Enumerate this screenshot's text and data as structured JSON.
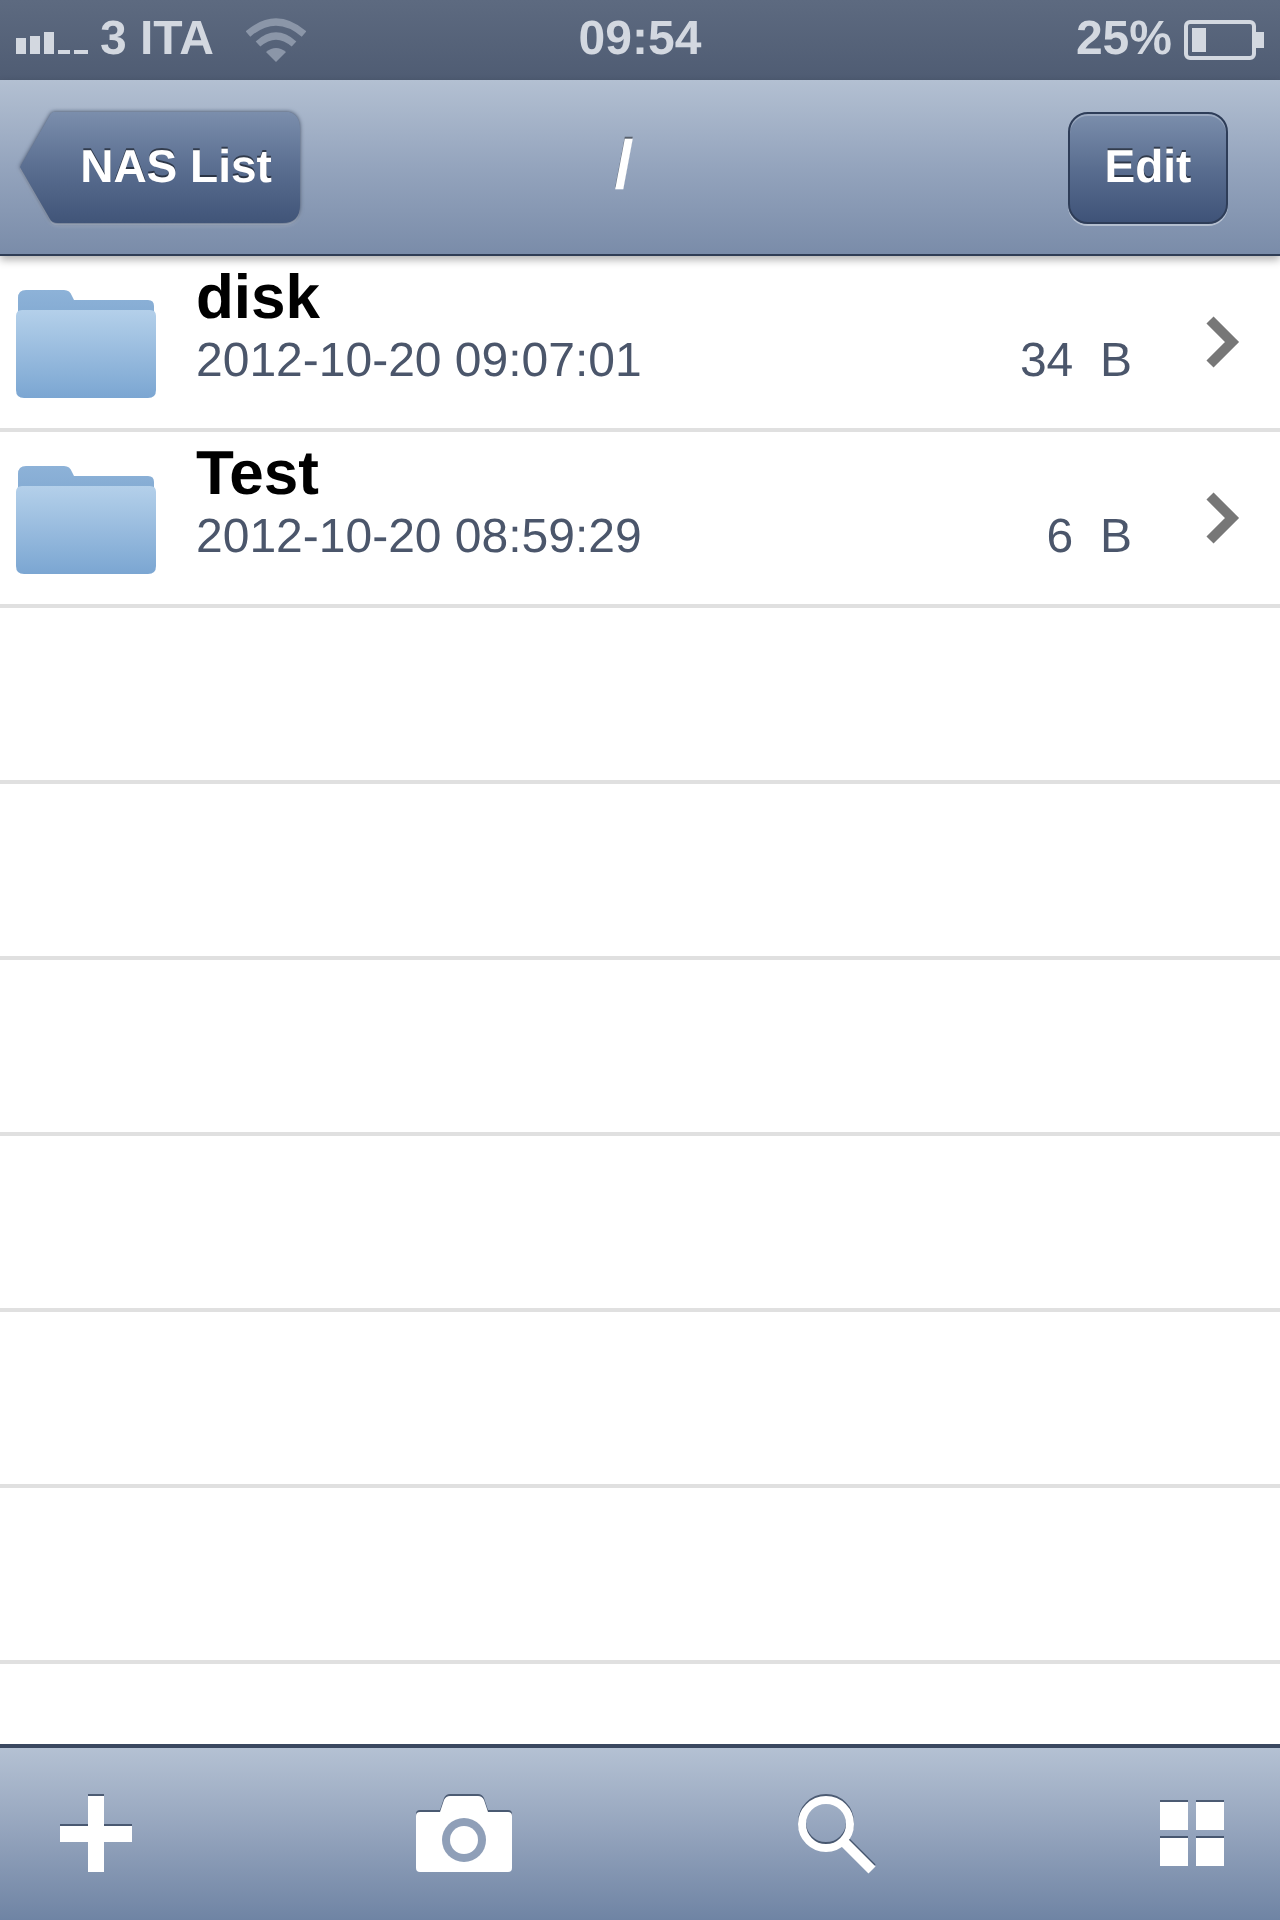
{
  "status_bar": {
    "carrier": "3 ITA",
    "time": "09:54",
    "battery": "25%"
  },
  "nav_bar": {
    "back_button": "NAS List",
    "title": "/",
    "edit_button": "Edit"
  },
  "files": [
    {
      "name": "disk",
      "modified": "2012-10-20 09:07:01",
      "size": "34  B"
    },
    {
      "name": "Test",
      "modified": "2012-10-20 08:59:29",
      "size": "6  B"
    }
  ],
  "toolbar": {
    "buttons": [
      {
        "kind": "add"
      },
      {
        "kind": "camera"
      },
      {
        "kind": "search"
      },
      {
        "kind": "grid"
      }
    ]
  }
}
